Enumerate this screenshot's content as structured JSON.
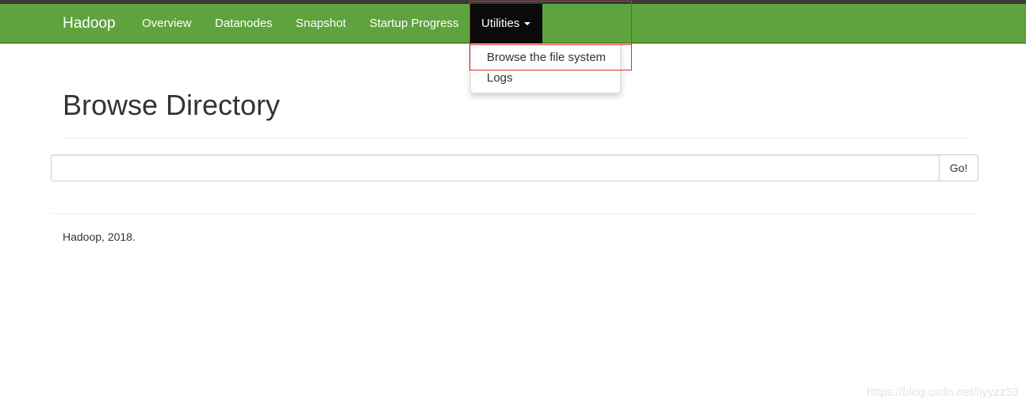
{
  "navbar": {
    "brand": "Hadoop",
    "items": [
      {
        "label": "Overview"
      },
      {
        "label": "Datanodes"
      },
      {
        "label": "Snapshot"
      },
      {
        "label": "Startup Progress"
      },
      {
        "label": "Utilities",
        "active": true
      }
    ],
    "color": "#5fa33e",
    "active_color": "#0a0a0a"
  },
  "utilities_menu": {
    "items": [
      {
        "label": "Browse the file system",
        "highlighted": true
      },
      {
        "label": "Logs"
      }
    ]
  },
  "main": {
    "title": "Browse Directory",
    "path_input": {
      "value": "",
      "placeholder": ""
    },
    "go_label": "Go!"
  },
  "footer": {
    "text": "Hadoop, 2018."
  },
  "watermark": "https://blog.csdn.net/liyyzz33",
  "colors": {
    "annotation_box": "#e02a2a"
  },
  "icons": [
    "caret-down-icon"
  ]
}
